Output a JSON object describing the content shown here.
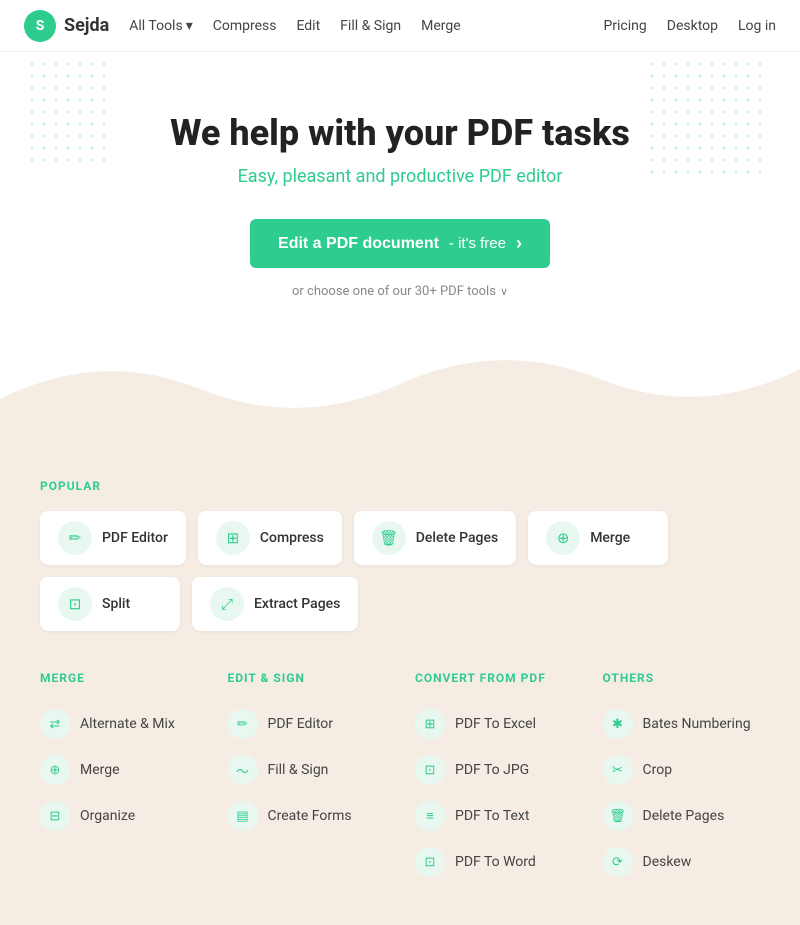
{
  "nav": {
    "logo_letter": "S",
    "logo_text": "Sejda",
    "links": [
      {
        "label": "All Tools",
        "has_arrow": true
      },
      {
        "label": "Compress"
      },
      {
        "label": "Edit"
      },
      {
        "label": "Fill & Sign"
      },
      {
        "label": "Merge"
      }
    ],
    "right_links": [
      {
        "label": "Pricing"
      },
      {
        "label": "Desktop"
      },
      {
        "label": "Log in"
      }
    ]
  },
  "hero": {
    "heading": "We help with your PDF tasks",
    "subheading": "Easy, pleasant and productive PDF editor",
    "cta_label": "Edit a PDF document",
    "cta_suffix": "- it's free",
    "cta_arrow": "›",
    "sub_text": "or choose one of our 30+ PDF tools",
    "sub_chevron": "∨"
  },
  "popular": {
    "label": "POPULAR",
    "tools": [
      {
        "name": "PDF Editor",
        "icon": "✏"
      },
      {
        "name": "Compress",
        "icon": "⊞"
      },
      {
        "name": "Delete Pages",
        "icon": "🗑"
      },
      {
        "name": "Merge",
        "icon": "⊕"
      },
      {
        "name": "Split",
        "icon": "⊡"
      },
      {
        "name": "Extract Pages",
        "icon": "⤢"
      }
    ]
  },
  "categories": [
    {
      "label": "MERGE",
      "items": [
        {
          "name": "Alternate & Mix",
          "icon": "⇄"
        },
        {
          "name": "Merge",
          "icon": "⊕"
        },
        {
          "name": "Organize",
          "icon": "⊟"
        }
      ]
    },
    {
      "label": "EDIT & SIGN",
      "items": [
        {
          "name": "PDF Editor",
          "icon": "✏"
        },
        {
          "name": "Fill & Sign",
          "icon": "〜"
        },
        {
          "name": "Create Forms",
          "icon": "▤"
        }
      ]
    },
    {
      "label": "CONVERT FROM PDF",
      "items": [
        {
          "name": "PDF To Excel",
          "icon": "⊞"
        },
        {
          "name": "PDF To JPG",
          "icon": "⊡"
        },
        {
          "name": "PDF To Text",
          "icon": "≡"
        },
        {
          "name": "PDF To Word",
          "icon": "⊡"
        }
      ]
    },
    {
      "label": "OTHERS",
      "items": [
        {
          "name": "Bates Numbering",
          "icon": "✱"
        },
        {
          "name": "Crop",
          "icon": "✂"
        },
        {
          "name": "Delete Pages",
          "icon": "🗑"
        },
        {
          "name": "Deskew",
          "icon": "⟳"
        }
      ]
    }
  ]
}
